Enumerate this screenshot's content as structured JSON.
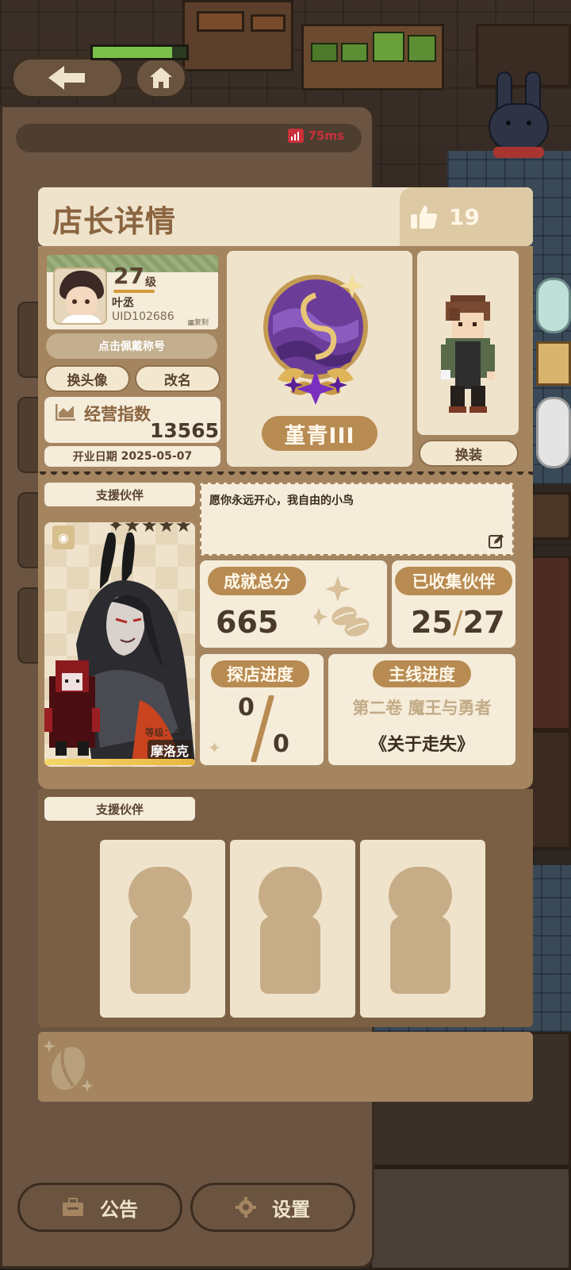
{
  "network": {
    "ping": "75ms"
  },
  "header": {
    "title": "店长详情",
    "likes": "19"
  },
  "profile": {
    "level": "27",
    "level_unit": "级",
    "name": "叶丞",
    "uid": "UID102686",
    "copy_label": "复制",
    "title_button": "点击佩戴称号",
    "change_avatar": "换头像",
    "rename": "改名",
    "business_index_label": "经营指数",
    "business_index_value": "13565",
    "open_date_label": "开业日期",
    "open_date": "2025-05-07",
    "rank": "堇青III",
    "outfit_button": "换装"
  },
  "partner": {
    "section_label": "支援伙伴",
    "motto": "愿你永远开心，我自由的小鸟",
    "name": "摩洛克",
    "level_label": "等级：48",
    "stars": 5
  },
  "stats": {
    "achievement_label": "成就总分",
    "achievement_value": "665",
    "collected_label": "已收集伙伴",
    "collected_current": "25",
    "collected_total": "27",
    "explore_label": "探店进度",
    "explore_current": "0",
    "explore_total": "0",
    "mainline_label": "主线进度",
    "mainline_volume": "第二卷 魔王与勇者",
    "mainline_chapter": "《关于走失》"
  },
  "support_slots": {
    "section_label": "支援伙伴",
    "count": 3
  },
  "bottom": {
    "notice": "公告",
    "settings": "设置"
  },
  "colors": {
    "accent": "#b88b52",
    "panel": "#a48560",
    "cream": "#efe3cc"
  },
  "icons": [
    "back-arrow-icon",
    "home-icon",
    "signal-icon",
    "thumbs-up-icon",
    "chart-icon",
    "edit-icon",
    "briefcase-icon",
    "gear-icon",
    "coffee-bean-icon"
  ]
}
